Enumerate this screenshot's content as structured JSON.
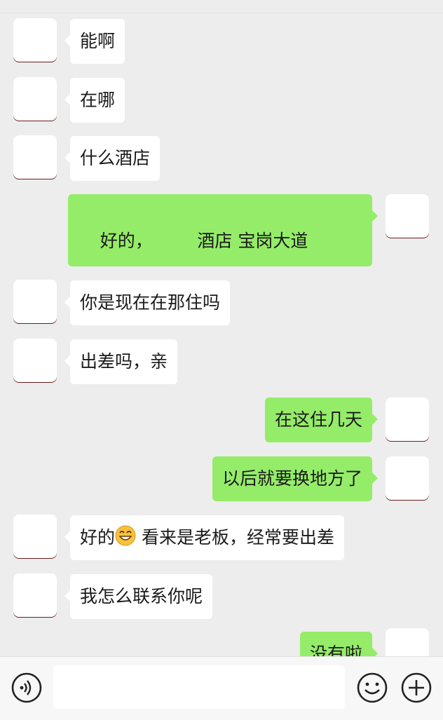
{
  "messages": [
    {
      "side": "in",
      "text": "能啊"
    },
    {
      "side": "in",
      "text": "在哪"
    },
    {
      "side": "in",
      "text": "什么酒店"
    },
    {
      "side": "out",
      "text": "好的，        酒店 宝岗大道"
    },
    {
      "side": "in",
      "text": "你是现在在那住吗"
    },
    {
      "side": "in",
      "text": "出差吗，亲"
    },
    {
      "side": "out",
      "text": "在这住几天"
    },
    {
      "side": "out",
      "text": "以后就要换地方了"
    },
    {
      "side": "in",
      "text_before": "好的",
      "emoji": "grinning-face",
      "text_after": " 看来是老板，经常要出差"
    },
    {
      "side": "in",
      "text": "我怎么联系你呢"
    },
    {
      "side": "out",
      "text": "没有啦"
    }
  ],
  "input_bar": {
    "icons": [
      "voice-icon",
      "emoji-icon",
      "plus-icon"
    ],
    "input_value": ""
  },
  "colors": {
    "background": "#ededed",
    "bubble_out": "#95ec69",
    "bubble_in": "#ffffff"
  }
}
